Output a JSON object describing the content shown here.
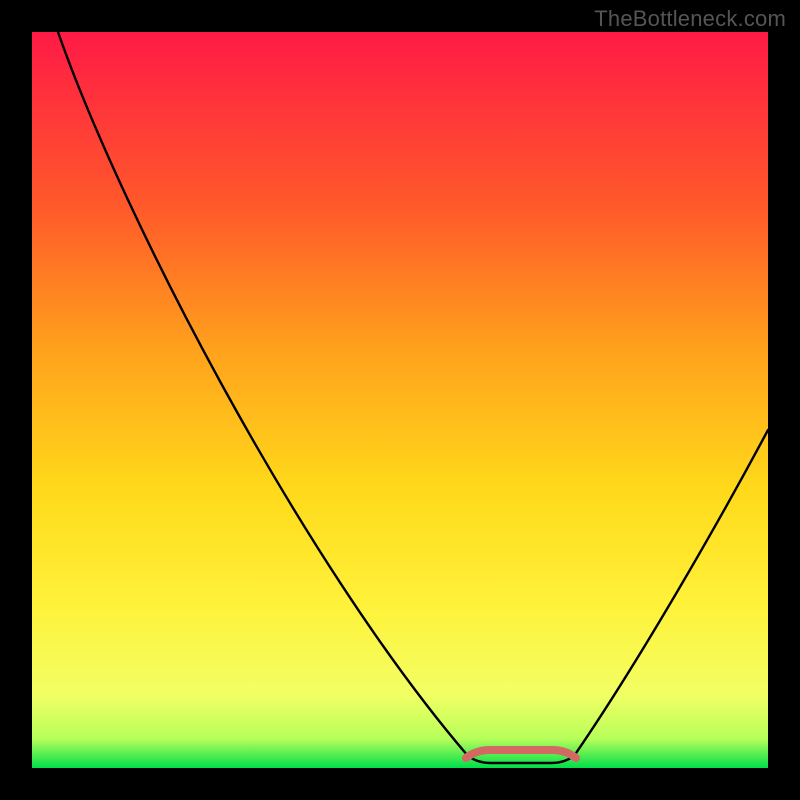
{
  "watermark": "TheBottleneck.com",
  "chart_data": {
    "type": "line",
    "title": "",
    "xlabel": "",
    "ylabel": "",
    "xlim": [
      0,
      100
    ],
    "ylim": [
      0,
      100
    ],
    "grid": false,
    "legend": false,
    "background_gradient": {
      "top_color": "#ff1a46",
      "upper_mid_color": "#ff8a1f",
      "mid_color": "#ffe21a",
      "lower_color": "#f6ff6a",
      "bottom_color": "#00df4a"
    },
    "v_curve": {
      "left_start": {
        "x": 4,
        "y": 100
      },
      "minimum_plateau": {
        "x_start": 60,
        "x_end": 72,
        "y": 1
      },
      "right_end": {
        "x": 100,
        "y": 55
      }
    },
    "bottom_bump": {
      "x_start": 58.5,
      "x_end": 73.5,
      "height": 1.2,
      "color": "#d26a63"
    },
    "frame_border_color": "#000000",
    "frame_border_width": 32
  }
}
